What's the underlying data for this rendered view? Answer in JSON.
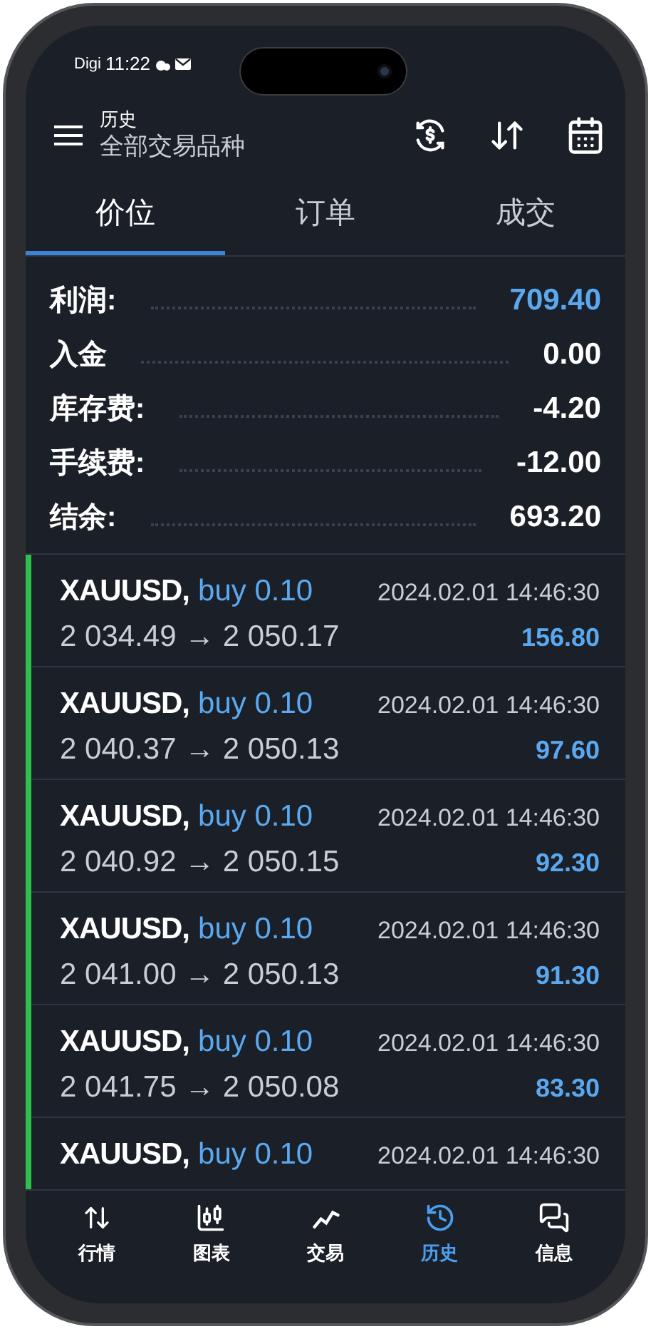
{
  "status_bar": {
    "carrier": "Digi",
    "time": "11:22"
  },
  "header": {
    "title": "历史",
    "subtitle": "全部交易品种"
  },
  "tabs": [
    {
      "label": "价位",
      "selected": true
    },
    {
      "label": "订单",
      "selected": false
    },
    {
      "label": "成交",
      "selected": false
    }
  ],
  "summary": [
    {
      "label": "利润:",
      "value": "709.40",
      "highlight": true
    },
    {
      "label": "入金",
      "value": "0.00",
      "highlight": false
    },
    {
      "label": "库存费:",
      "value": "-4.20",
      "highlight": false
    },
    {
      "label": "手续费:",
      "value": "-12.00",
      "highlight": false
    },
    {
      "label": "结余:",
      "value": "693.20",
      "highlight": false
    }
  ],
  "deals": [
    {
      "symbol": "XAUUSD,",
      "side": "buy 0.10",
      "time": "2024.02.01 14:46:30",
      "prices": "2 034.49 → 2 050.17",
      "profit": "156.80"
    },
    {
      "symbol": "XAUUSD,",
      "side": "buy 0.10",
      "time": "2024.02.01 14:46:30",
      "prices": "2 040.37 → 2 050.13",
      "profit": "97.60"
    },
    {
      "symbol": "XAUUSD,",
      "side": "buy 0.10",
      "time": "2024.02.01 14:46:30",
      "prices": "2 040.92 → 2 050.15",
      "profit": "92.30"
    },
    {
      "symbol": "XAUUSD,",
      "side": "buy 0.10",
      "time": "2024.02.01 14:46:30",
      "prices": "2 041.00 → 2 050.13",
      "profit": "91.30"
    },
    {
      "symbol": "XAUUSD,",
      "side": "buy 0.10",
      "time": "2024.02.01 14:46:30",
      "prices": "2 041.75 → 2 050.08",
      "profit": "83.30"
    },
    {
      "symbol": "XAUUSD,",
      "side": "buy 0.10",
      "time": "2024.02.01 14:46:30"
    }
  ],
  "nav": [
    {
      "label": "行情",
      "kind": "quotes",
      "selected": false
    },
    {
      "label": "图表",
      "kind": "chart",
      "selected": false
    },
    {
      "label": "交易",
      "kind": "trade",
      "selected": false
    },
    {
      "label": "历史",
      "kind": "history",
      "selected": true
    },
    {
      "label": "信息",
      "kind": "messages",
      "selected": false
    }
  ]
}
